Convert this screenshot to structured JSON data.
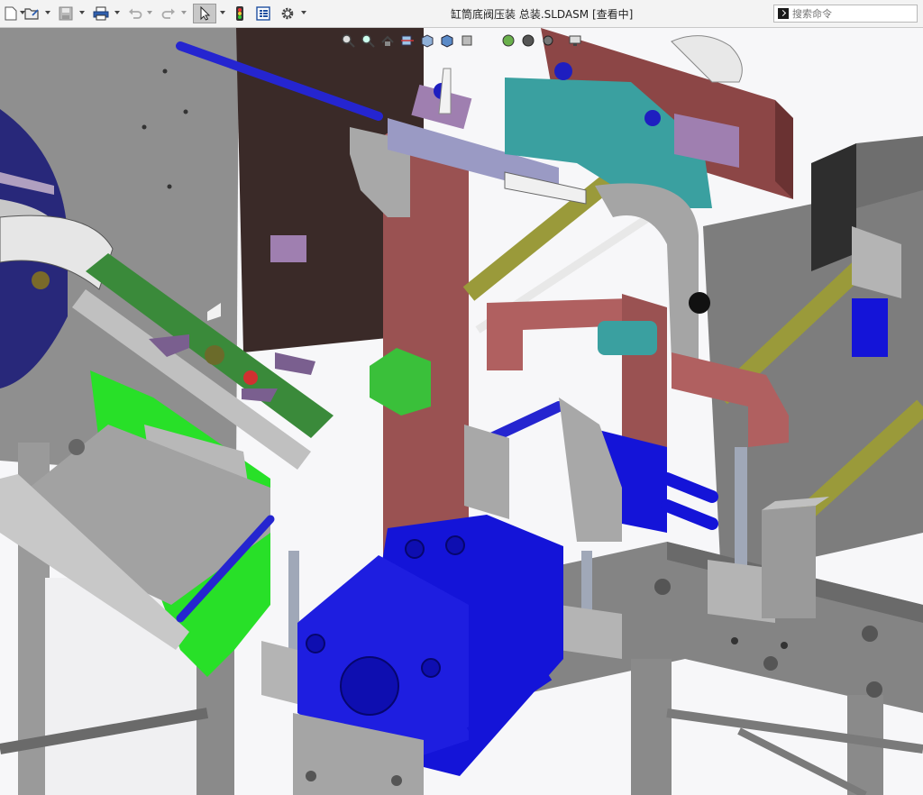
{
  "window": {
    "title": "缸筒底阀压装 总装.SLDASM [查看中]"
  },
  "toolbar": {
    "icons": [
      "new-document-icon",
      "open-folder-icon",
      "save-icon",
      "print-icon",
      "undo-icon",
      "redo-icon",
      "select-pointer-icon",
      "rebuild-traffic-light-icon",
      "file-properties-icon",
      "options-gear-icon"
    ]
  },
  "search": {
    "placeholder": "搜索命令"
  },
  "heads_up_toolbar": {
    "icons": [
      "zoom-to-fit-icon",
      "zoom-to-area-icon",
      "previous-view-icon",
      "section-view-icon",
      "view-orientation-icon",
      "display-style-icon",
      "hide-show-items-icon",
      "edit-appearance-icon",
      "apply-scene-icon",
      "view-settings-icon",
      "display-pane-icon"
    ]
  },
  "colors": {
    "cylinder_blue": "#1414d8",
    "frame_gray": "#8e8e8e",
    "plate_maroon": "#8c4646",
    "dark_panel": "#3a2a28",
    "bracket_green": "#28e028",
    "rod_olive": "#9a9a3a",
    "teal_part": "#3aa0a0",
    "lilac_part": "#9f7fb0",
    "navy_bowl": "#28287a"
  }
}
